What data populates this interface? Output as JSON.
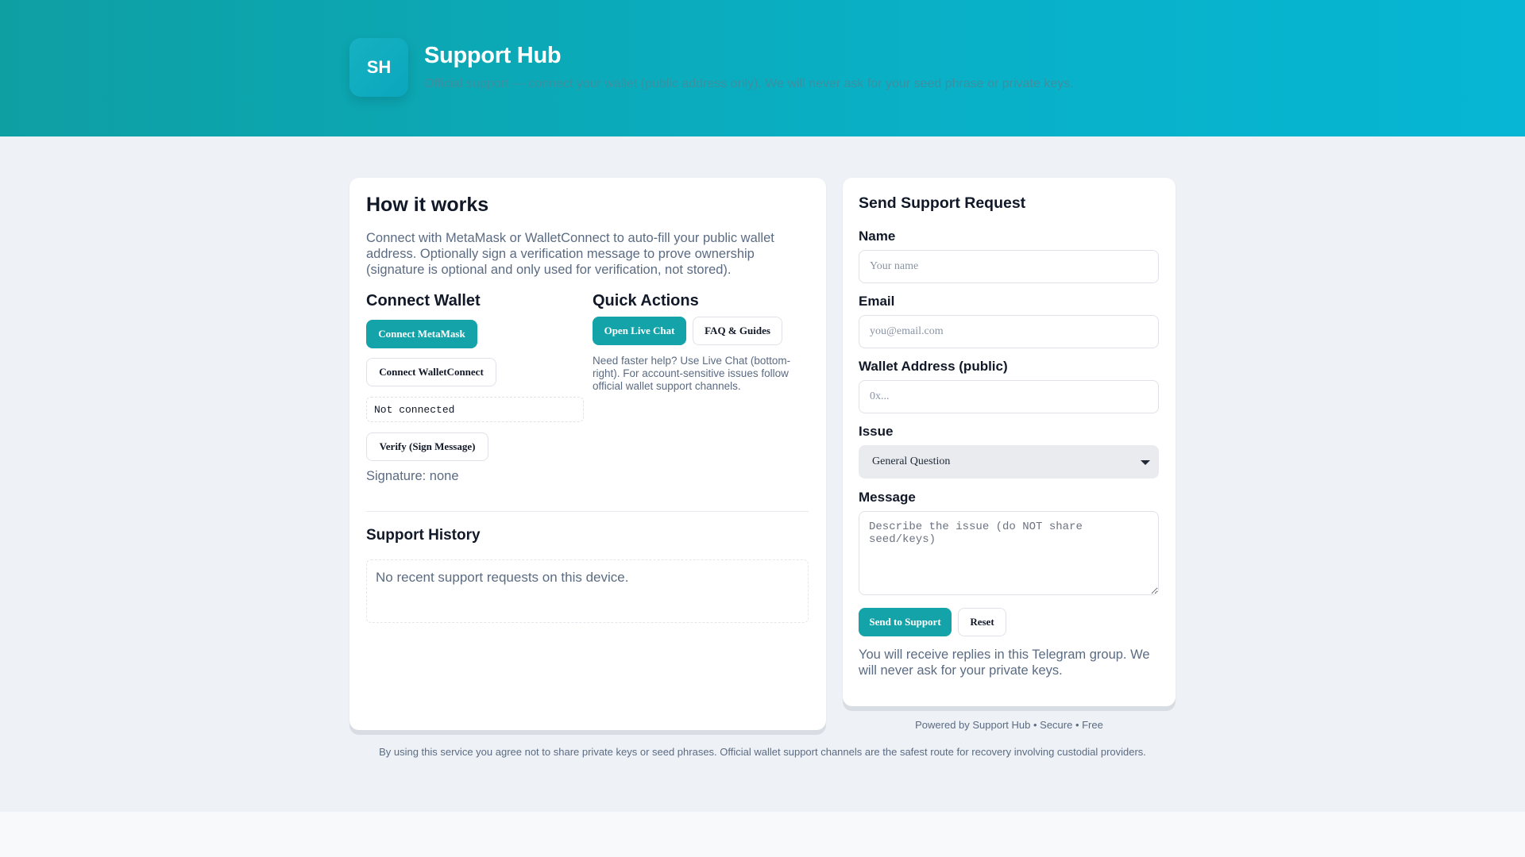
{
  "header": {
    "logo_initials": "SH",
    "title": "Support Hub",
    "subtitle": "Official support — connect your wallet (public address only). We will never ask for your seed phrase or private keys."
  },
  "how_it_works": {
    "title": "How it works",
    "description": "Connect with MetaMask or WalletConnect to auto-fill your public wallet address. Optionally sign a verification message to prove ownership (signature is optional and only used for verification, not stored)."
  },
  "connect_wallet": {
    "title": "Connect Wallet",
    "metamask_button": "Connect MetaMask",
    "walletconnect_button": "Connect WalletConnect",
    "status": "Not connected",
    "verify_button": "Verify (Sign Message)",
    "signature": "Signature: none"
  },
  "quick_actions": {
    "title": "Quick Actions",
    "live_chat_button": "Open Live Chat",
    "faq_button": "FAQ & Guides",
    "note": "Need faster help? Use Live Chat (bottom-right). For account-sensitive issues follow official wallet support channels."
  },
  "support_history": {
    "title": "Support History",
    "empty_text": "No recent support requests on this device."
  },
  "form": {
    "title": "Send Support Request",
    "name_label": "Name",
    "name_placeholder": "Your name",
    "email_label": "Email",
    "email_placeholder": "you@email.com",
    "wallet_label": "Wallet Address (public)",
    "wallet_placeholder": "0x...",
    "issue_label": "Issue",
    "issue_selected": "General Question",
    "message_label": "Message",
    "message_placeholder": "Describe the issue (do NOT share seed/keys)",
    "send_button": "Send to Support",
    "reset_button": "Reset",
    "reply_note": "You will receive replies in this Telegram group. We will never ask for your private keys."
  },
  "footer": {
    "powered_by": "Powered by Support Hub • Secure • Free",
    "disclaimer": "By using this service you agree not to share private keys or seed phrases. Official wallet support channels are the safest route for recovery involving custodial providers."
  },
  "colors": {
    "accent": "#14a3a8",
    "hero_start": "#0e9fa3",
    "hero_end": "#06b6d4"
  }
}
